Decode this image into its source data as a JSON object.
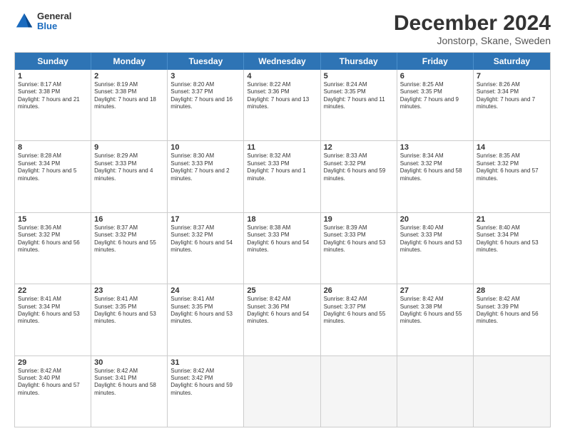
{
  "header": {
    "logo": {
      "general": "General",
      "blue": "Blue"
    },
    "title": "December 2024",
    "location": "Jonstorp, Skane, Sweden"
  },
  "weekdays": [
    "Sunday",
    "Monday",
    "Tuesday",
    "Wednesday",
    "Thursday",
    "Friday",
    "Saturday"
  ],
  "weeks": [
    [
      {
        "day": "1",
        "sunrise": "8:17 AM",
        "sunset": "3:38 PM",
        "daylight": "7 hours and 21 minutes."
      },
      {
        "day": "2",
        "sunrise": "8:19 AM",
        "sunset": "3:38 PM",
        "daylight": "7 hours and 18 minutes."
      },
      {
        "day": "3",
        "sunrise": "8:20 AM",
        "sunset": "3:37 PM",
        "daylight": "7 hours and 16 minutes."
      },
      {
        "day": "4",
        "sunrise": "8:22 AM",
        "sunset": "3:36 PM",
        "daylight": "7 hours and 13 minutes."
      },
      {
        "day": "5",
        "sunrise": "8:24 AM",
        "sunset": "3:35 PM",
        "daylight": "7 hours and 11 minutes."
      },
      {
        "day": "6",
        "sunrise": "8:25 AM",
        "sunset": "3:35 PM",
        "daylight": "7 hours and 9 minutes."
      },
      {
        "day": "7",
        "sunrise": "8:26 AM",
        "sunset": "3:34 PM",
        "daylight": "7 hours and 7 minutes."
      }
    ],
    [
      {
        "day": "8",
        "sunrise": "8:28 AM",
        "sunset": "3:34 PM",
        "daylight": "7 hours and 5 minutes."
      },
      {
        "day": "9",
        "sunrise": "8:29 AM",
        "sunset": "3:33 PM",
        "daylight": "7 hours and 4 minutes."
      },
      {
        "day": "10",
        "sunrise": "8:30 AM",
        "sunset": "3:33 PM",
        "daylight": "7 hours and 2 minutes."
      },
      {
        "day": "11",
        "sunrise": "8:32 AM",
        "sunset": "3:33 PM",
        "daylight": "7 hours and 1 minute."
      },
      {
        "day": "12",
        "sunrise": "8:33 AM",
        "sunset": "3:32 PM",
        "daylight": "6 hours and 59 minutes."
      },
      {
        "day": "13",
        "sunrise": "8:34 AM",
        "sunset": "3:32 PM",
        "daylight": "6 hours and 58 minutes."
      },
      {
        "day": "14",
        "sunrise": "8:35 AM",
        "sunset": "3:32 PM",
        "daylight": "6 hours and 57 minutes."
      }
    ],
    [
      {
        "day": "15",
        "sunrise": "8:36 AM",
        "sunset": "3:32 PM",
        "daylight": "6 hours and 56 minutes."
      },
      {
        "day": "16",
        "sunrise": "8:37 AM",
        "sunset": "3:32 PM",
        "daylight": "6 hours and 55 minutes."
      },
      {
        "day": "17",
        "sunrise": "8:37 AM",
        "sunset": "3:32 PM",
        "daylight": "6 hours and 54 minutes."
      },
      {
        "day": "18",
        "sunrise": "8:38 AM",
        "sunset": "3:33 PM",
        "daylight": "6 hours and 54 minutes."
      },
      {
        "day": "19",
        "sunrise": "8:39 AM",
        "sunset": "3:33 PM",
        "daylight": "6 hours and 53 minutes."
      },
      {
        "day": "20",
        "sunrise": "8:40 AM",
        "sunset": "3:33 PM",
        "daylight": "6 hours and 53 minutes."
      },
      {
        "day": "21",
        "sunrise": "8:40 AM",
        "sunset": "3:34 PM",
        "daylight": "6 hours and 53 minutes."
      }
    ],
    [
      {
        "day": "22",
        "sunrise": "8:41 AM",
        "sunset": "3:34 PM",
        "daylight": "6 hours and 53 minutes."
      },
      {
        "day": "23",
        "sunrise": "8:41 AM",
        "sunset": "3:35 PM",
        "daylight": "6 hours and 53 minutes."
      },
      {
        "day": "24",
        "sunrise": "8:41 AM",
        "sunset": "3:35 PM",
        "daylight": "6 hours and 53 minutes."
      },
      {
        "day": "25",
        "sunrise": "8:42 AM",
        "sunset": "3:36 PM",
        "daylight": "6 hours and 54 minutes."
      },
      {
        "day": "26",
        "sunrise": "8:42 AM",
        "sunset": "3:37 PM",
        "daylight": "6 hours and 55 minutes."
      },
      {
        "day": "27",
        "sunrise": "8:42 AM",
        "sunset": "3:38 PM",
        "daylight": "6 hours and 55 minutes."
      },
      {
        "day": "28",
        "sunrise": "8:42 AM",
        "sunset": "3:39 PM",
        "daylight": "6 hours and 56 minutes."
      }
    ],
    [
      {
        "day": "29",
        "sunrise": "8:42 AM",
        "sunset": "3:40 PM",
        "daylight": "6 hours and 57 minutes."
      },
      {
        "day": "30",
        "sunrise": "8:42 AM",
        "sunset": "3:41 PM",
        "daylight": "6 hours and 58 minutes."
      },
      {
        "day": "31",
        "sunrise": "8:42 AM",
        "sunset": "3:42 PM",
        "daylight": "6 hours and 59 minutes."
      },
      null,
      null,
      null,
      null
    ]
  ]
}
